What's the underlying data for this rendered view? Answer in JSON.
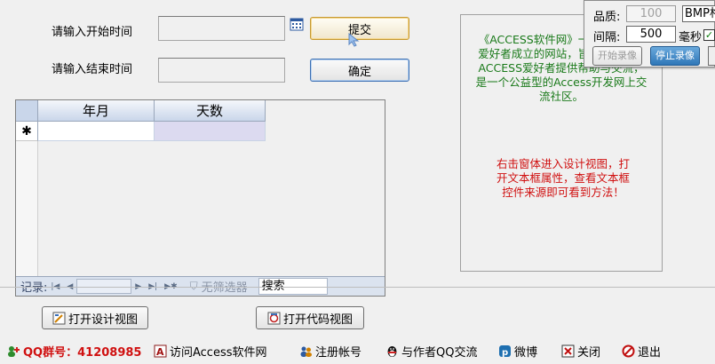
{
  "form": {
    "start_label": "请输入开始时间",
    "end_label": "请输入结束时间",
    "start_value": "",
    "end_value": "",
    "submit_label": "提交",
    "confirm_label": "确定"
  },
  "datasheet": {
    "columns": [
      "年月",
      "天数"
    ],
    "new_row_marker": "✱",
    "nav": {
      "record_label": "记录:",
      "record_value": "",
      "filter_label": "无筛选器",
      "search_label": "搜索"
    }
  },
  "info_panel": {
    "intro_text": "《ACCESS软件网》一群ACCESS爱好者成立的网站，旨在无偿地为ACCESS爱好者提供帮助与交流，是一个公益型的Access开发网上交流社区。",
    "intro_color": "#1a7a1a",
    "hint_text": "右击窗体进入设计视图，打开文本框属性，查看文本框控件来源即可看到方法！",
    "hint_color": "#d01010"
  },
  "capture_panel": {
    "quality_label": "品质:",
    "quality_value": "100",
    "format_value": "BMP格",
    "interval_label": "间隔:",
    "interval_value": "500",
    "unit_label": "毫秒",
    "start_button": "开始录像",
    "stop_button": "停止录像"
  },
  "view_buttons": {
    "design_label": "打开设计视图",
    "code_label": "打开代码视图"
  },
  "footer": {
    "qq_group": "QQ群号：41208985",
    "visit_site": "访问Access软件网",
    "register": "注册帐号",
    "qq_author": "与作者QQ交流",
    "weibo": "微博",
    "close": "关闭",
    "exit": "退出"
  }
}
